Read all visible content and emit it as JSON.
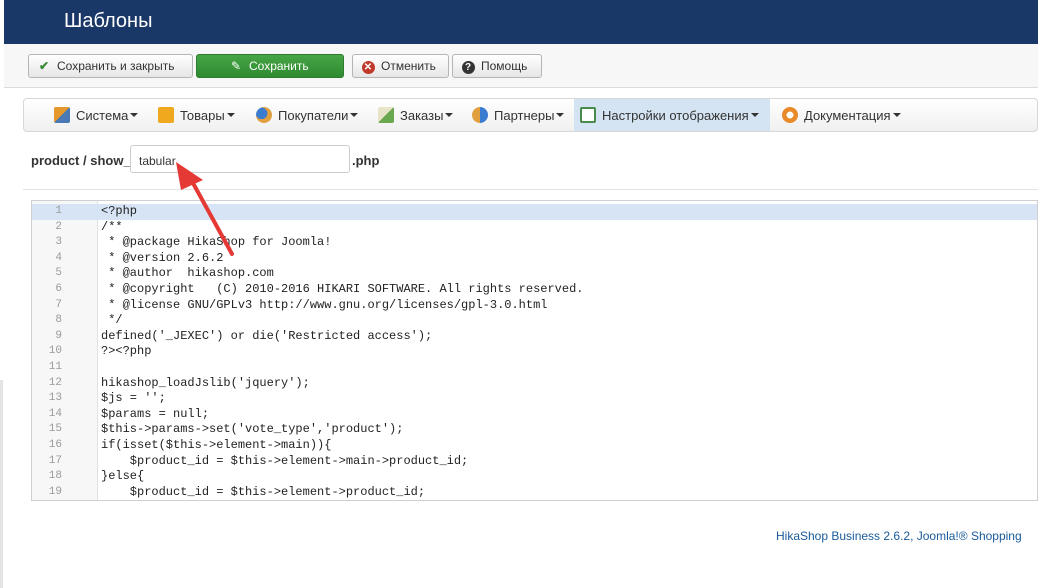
{
  "header": {
    "title": "Шаблоны"
  },
  "toolbar": {
    "save_close_label": "Сохранить и закрыть",
    "save_label": "Сохранить",
    "cancel_label": "Отменить",
    "help_label": "Помощь"
  },
  "menu": {
    "items": [
      {
        "label": "Система",
        "icon": "wrench-icon"
      },
      {
        "label": "Товары",
        "icon": "box-icon"
      },
      {
        "label": "Покупатели",
        "icon": "users-icon"
      },
      {
        "label": "Заказы",
        "icon": "orders-icon"
      },
      {
        "label": "Партнеры",
        "icon": "partner-icon"
      },
      {
        "label": "Настройки отображения",
        "icon": "display-icon"
      },
      {
        "label": "Документация",
        "icon": "docs-icon"
      }
    ]
  },
  "file": {
    "prefix": "product / show_",
    "value": "tabular",
    "suffix": ".php"
  },
  "editor": {
    "lines": [
      "<?php",
      "/**",
      " * @package HikaShop for Joomla!",
      " * @version 2.6.2",
      " * @author  hikashop.com",
      " * @copyright   (C) 2010-2016 HIKARI SOFTWARE. All rights reserved.",
      " * @license GNU/GPLv3 http://www.gnu.org/licenses/gpl-3.0.html",
      " */",
      "defined('_JEXEC') or die('Restricted access');",
      "?><?php",
      "",
      "hikashop_loadJslib('jquery');",
      "$js = '';",
      "$params = null;",
      "$this->params->set('vote_type','product');",
      "if(isset($this->element->main)){",
      "    $product_id = $this->element->main->product_id;",
      "}else{",
      "    $product_id = $this->element->product_id;"
    ],
    "line_numbers": [
      "1",
      "2",
      "3",
      "4",
      "5",
      "6",
      "7",
      "8",
      "9",
      "10",
      "11",
      "12",
      "13",
      "14",
      "15",
      "16",
      "17",
      "18",
      "19"
    ]
  },
  "footer": {
    "text": "HikaShop Business 2.6.2, Joomla!® Shopping"
  },
  "colors": {
    "header_bg": "#1a3867",
    "save_green": "#3a9a3a",
    "arrow_red": "#e53935"
  }
}
